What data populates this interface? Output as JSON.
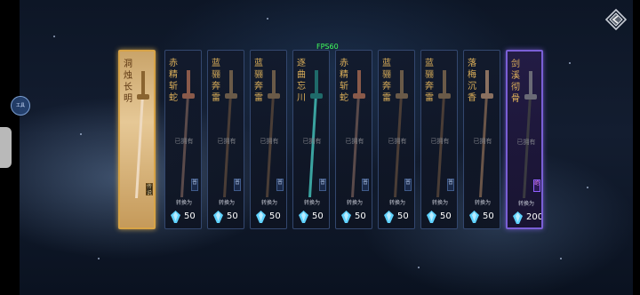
{
  "hud": {
    "fps": "FPS60",
    "float_button": "工具"
  },
  "cards": [
    {
      "name": "洞烛长明",
      "variant": "gold",
      "blade": "#eedac0",
      "hilt": "#8a6430",
      "badge": "传说",
      "owned": "",
      "convert": "",
      "price": ""
    },
    {
      "name": "赤精斩蛇",
      "variant": "normal",
      "blade": "#5a4a4a",
      "hilt": "#8a5a4a",
      "badge": "普",
      "owned": "已拥有",
      "convert": "转换为",
      "price": "50"
    },
    {
      "name": "蓝骊奔雷",
      "variant": "normal",
      "blade": "#4a3d36",
      "hilt": "#6a5a48",
      "badge": "普",
      "owned": "已拥有",
      "convert": "转换为",
      "price": "50"
    },
    {
      "name": "蓝骊奔雷",
      "variant": "normal",
      "blade": "#4a3d36",
      "hilt": "#6a5a48",
      "badge": "普",
      "owned": "已拥有",
      "convert": "转换为",
      "price": "50"
    },
    {
      "name": "逐曲忘川",
      "variant": "normal",
      "blade": "#3aa3a0",
      "hilt": "#1f6a6a",
      "badge": "普",
      "owned": "已拥有",
      "convert": "转换为",
      "price": "50"
    },
    {
      "name": "赤精斩蛇",
      "variant": "normal",
      "blade": "#5a4a4a",
      "hilt": "#8a5a4a",
      "badge": "普",
      "owned": "已拥有",
      "convert": "转换为",
      "price": "50"
    },
    {
      "name": "蓝骊奔雷",
      "variant": "normal",
      "blade": "#4a3d36",
      "hilt": "#6a5a48",
      "badge": "普",
      "owned": "已拥有",
      "convert": "转换为",
      "price": "50"
    },
    {
      "name": "蓝骊奔雷",
      "variant": "normal",
      "blade": "#4a3d36",
      "hilt": "#6a5a48",
      "badge": "普",
      "owned": "已拥有",
      "convert": "转换为",
      "price": "50"
    },
    {
      "name": "落梅沉香",
      "variant": "normal",
      "blade": "#6a5548",
      "hilt": "#8a7060",
      "badge": "",
      "owned": "已拥有",
      "convert": "转换为",
      "price": "50"
    },
    {
      "name": "剑溪彻骨",
      "variant": "purple",
      "blade": "#3a3a40",
      "hilt": "#6a6a76",
      "badge": "绝",
      "owned": "已拥有",
      "convert": "转换为",
      "price": "200"
    }
  ],
  "colors": {
    "gem": "#5fd2ff",
    "name_text": "#e0b25a",
    "fps_text": "#41ff5c"
  }
}
